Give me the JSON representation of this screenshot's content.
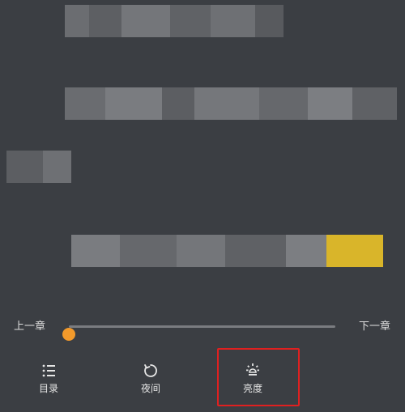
{
  "reader": {
    "progress_fraction": 0.0
  },
  "progress": {
    "prev_label": "上一章",
    "next_label": "下一章"
  },
  "tabs": [
    {
      "label": "目录",
      "icon": "list-icon"
    },
    {
      "label": "夜间",
      "icon": "night-mode-icon"
    },
    {
      "label": "亮度",
      "icon": "brightness-icon"
    }
  ],
  "colors": {
    "accent": "#f39a2b",
    "highlight": "#e02020",
    "background": "#3b3e43"
  }
}
